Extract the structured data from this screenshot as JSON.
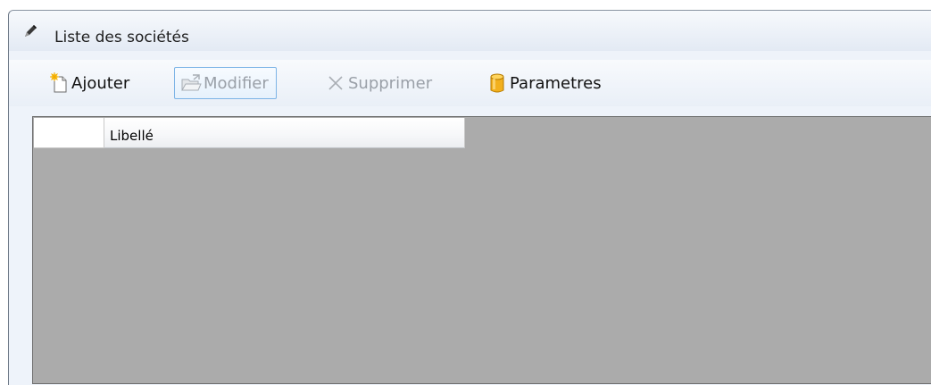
{
  "window": {
    "title": "Liste des sociétés",
    "title_icon": "pencil-icon"
  },
  "toolbar": {
    "add": {
      "label": "Ajouter",
      "icon": "new-document-icon",
      "enabled": true
    },
    "edit": {
      "label": "Modifier",
      "icon": "edit-folder-icon",
      "enabled": false,
      "focused": true
    },
    "delete": {
      "label": "Supprimer",
      "icon": "close-x-icon",
      "enabled": false
    },
    "settings": {
      "label": "Parametres",
      "icon": "database-cylinder-icon",
      "enabled": true
    }
  },
  "grid": {
    "columns": [
      "Libellé"
    ],
    "rows": []
  },
  "colors": {
    "grid_background": "#ababab",
    "focus_border": "#7db4e6",
    "database_icon": "#f2b01e"
  }
}
